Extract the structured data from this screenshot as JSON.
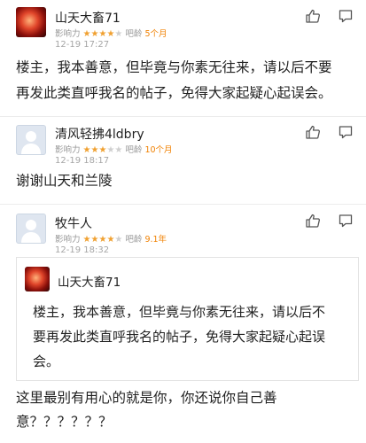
{
  "posts": [
    {
      "username": "山天大畜71",
      "influence_label": "影响力",
      "stars_on": "★★★★",
      "stars_off": "★",
      "age_prefix": "吧龄 ",
      "age_value": "5个月",
      "time": "12-19 17:27",
      "text_line1": "楼主，我本善意，但毕竟与你素无往来，请以后不要",
      "text_line2": "再发此类直呼我名的帖子，免得大家起疑心起误会。"
    },
    {
      "username": "清风轻拂4ldbry",
      "influence_label": "影响力",
      "stars_on": "★★★",
      "stars_off": "★★",
      "age_prefix": "吧龄 ",
      "age_value": "10个月",
      "time": "12-19 18:17",
      "text_line1": "谢谢山天和兰陵"
    },
    {
      "username": "牧牛人",
      "influence_label": "影响力",
      "stars_on": "★★★★",
      "stars_off": "★",
      "age_prefix": "吧龄 ",
      "age_value": "9.1年",
      "time": "12-19 18:32",
      "quote": {
        "username": "山天大畜71",
        "text_line1": "楼主，我本善意，但毕竟与你素无往来，请以后不",
        "text_line2": "要再发此类直呼我名的帖子，免得大家起疑心起误",
        "text_line3": "会。"
      },
      "text_line1": "这里最别有用心的就是你，你还说你自己善",
      "text_line2": "意？？？？？？"
    }
  ],
  "colors": {
    "age_accent": "#f08000",
    "stars": "#f0a030",
    "meta": "#999999"
  },
  "icons": [
    "thumbs-up-icon",
    "reply-icon"
  ]
}
